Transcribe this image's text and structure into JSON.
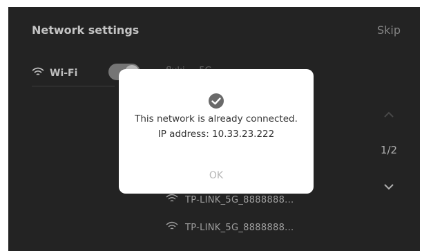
{
  "header": {
    "title": "Network settings",
    "skip_label": "Skip"
  },
  "wifi": {
    "label": "Wi-Fi",
    "enabled": true,
    "connected_network_partial": "fluki  ...  5G"
  },
  "pager": {
    "count": "1/2"
  },
  "networks": [
    {
      "name": "TP-LINK_5G_8888888..."
    },
    {
      "name": "TP-LINK_5G_8888888..."
    }
  ],
  "dialog": {
    "message_line1": "This network is already connected.",
    "message_line2": "IP address: 10.33.23.222",
    "ok_label": "OK"
  },
  "colors": {
    "screen_bg": "#2a2a2a",
    "dialog_bg": "#ffffff",
    "check_icon": "#6a6a6a"
  }
}
